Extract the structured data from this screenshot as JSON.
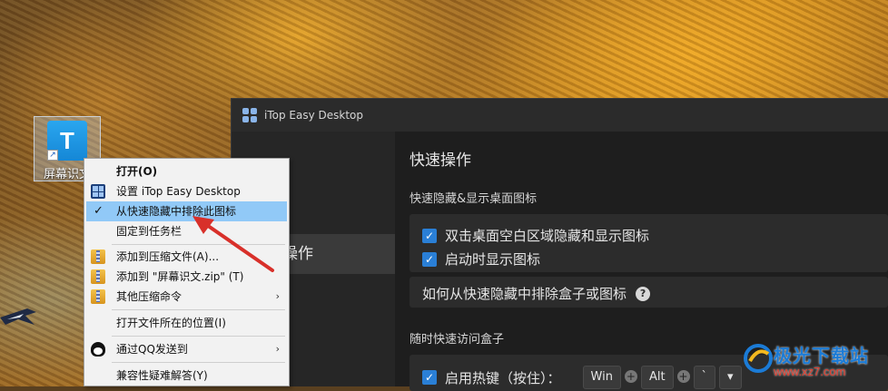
{
  "desktop": {
    "icon_glyph": "T",
    "icon_label": "屏幕识文"
  },
  "app": {
    "title": "iTop Easy Desktop",
    "sidebar_item": "操作",
    "page_title": "快速操作",
    "section1_title": "快速隐藏&显示桌面图标",
    "option1": "双击桌面空白区域隐藏和显示图标",
    "option2": "启动时显示图标",
    "help_text": "如何从快速隐藏中排除盒子或图标",
    "help_glyph": "?",
    "section2_title": "随时快速访问盒子",
    "hotkey_label": "启用热键（按住）：",
    "keys": [
      "Win",
      "Alt",
      "`"
    ],
    "checked_glyph": "✓",
    "dropdown_glyph": "▾"
  },
  "context_menu": {
    "items": [
      {
        "label": "打开(O)"
      },
      {
        "label": "设置 iTop Easy Desktop"
      },
      {
        "label": "从快速隐藏中排除此图标"
      },
      {
        "label": "固定到任务栏"
      },
      {
        "label": "添加到压缩文件(A)..."
      },
      {
        "label": "添加到 \"屏幕识文.zip\" (T)"
      },
      {
        "label": "其他压缩命令"
      },
      {
        "label": "打开文件所在的位置(I)"
      },
      {
        "label": "通过QQ发送到"
      },
      {
        "label": "兼容性疑难解答(Y)"
      }
    ],
    "submenu_glyph": "›",
    "check_glyph": "✓"
  },
  "watermark": {
    "brand": "极光下载站",
    "url": "www.xz7.com"
  },
  "colors": {
    "menu_highlight": "#91c9f7",
    "checkbox_blue": "#2a7fd6",
    "arrow_red": "#d8302a"
  }
}
